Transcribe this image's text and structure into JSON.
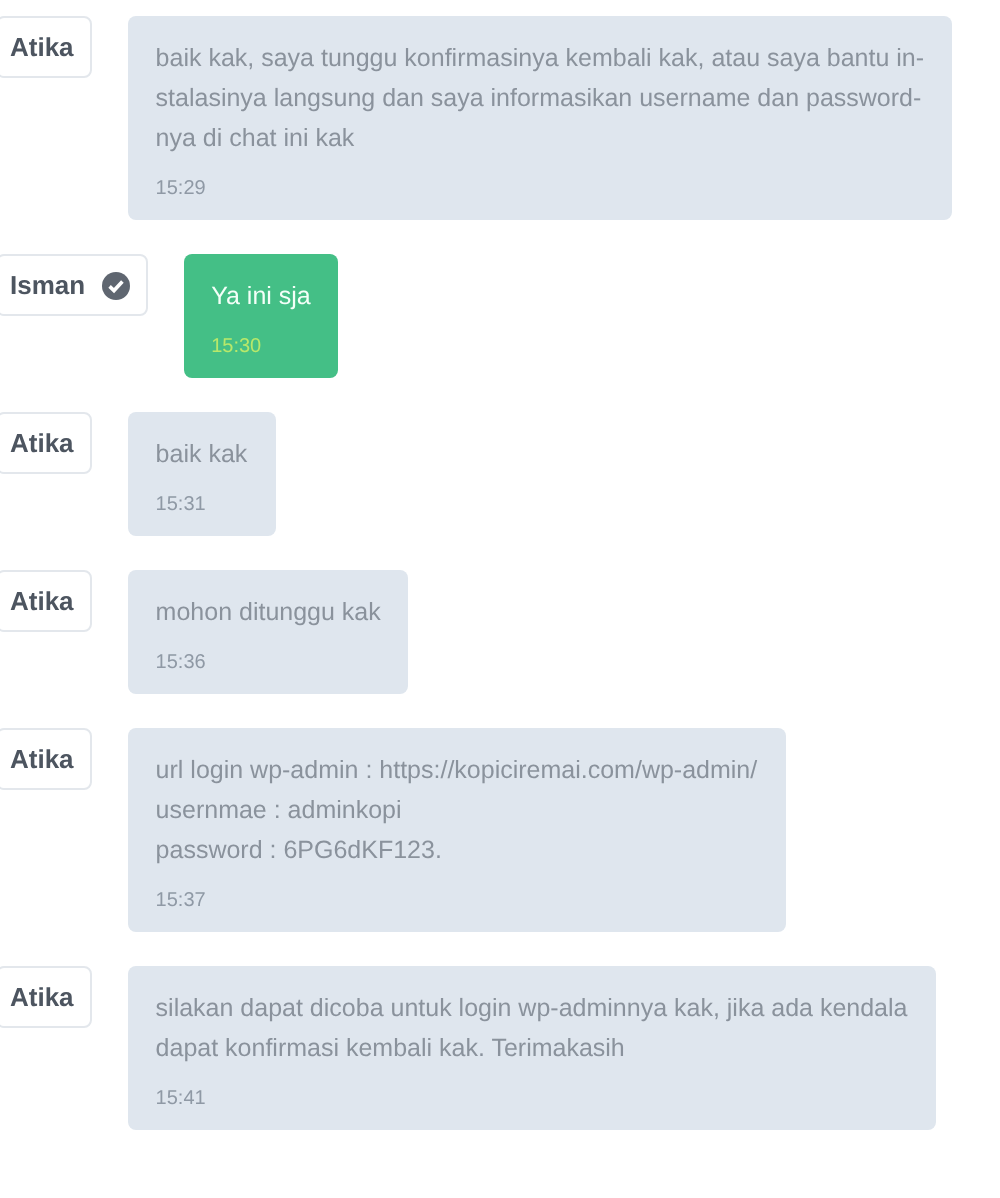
{
  "messages": [
    {
      "sender": "Atika",
      "verified": false,
      "kind": "incoming",
      "text": "baik kak, saya tunggu konfirmasinya kembali kak, atau saya bantu in-\nstalasinya langsung dan saya informasikan username dan password-\nnya di chat ini kak",
      "time": "15:29"
    },
    {
      "sender": "Isman",
      "verified": true,
      "kind": "outgoing",
      "text": "Ya ini sja",
      "time": "15:30"
    },
    {
      "sender": "Atika",
      "verified": false,
      "kind": "incoming",
      "text": "baik kak",
      "time": "15:31"
    },
    {
      "sender": "Atika",
      "verified": false,
      "kind": "incoming",
      "text": "mohon ditunggu kak",
      "time": "15:36"
    },
    {
      "sender": "Atika",
      "verified": false,
      "kind": "incoming",
      "text": "url login wp-admin : https://kopiciremai.com/wp-admin/\nusernmae : adminkopi\npassword : 6PG6dKF123.",
      "time": "15:37"
    },
    {
      "sender": "Atika",
      "verified": false,
      "kind": "incoming",
      "text": "silakan dapat dicoba untuk login wp-adminnya kak, jika ada kendala\ndapat konfirmasi kembali kak. Terimakasih",
      "time": "15:41"
    }
  ]
}
